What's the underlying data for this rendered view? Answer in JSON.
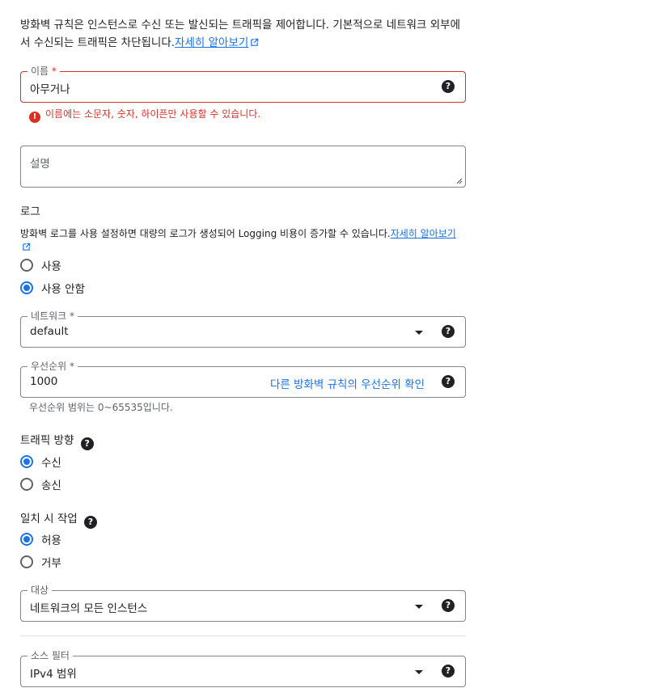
{
  "intro": {
    "text": "방화벽 규칙은 인스턴스로 수신 또는 발신되는 트래픽을 제어합니다. 기본적으로 네트워크 외부에서 수신되는 트래픽은 차단됩니다.",
    "link": "자세히 알아보기"
  },
  "name_field": {
    "label": "이름",
    "required_mark": "*",
    "value": "아무거나",
    "error_icon": "!",
    "error": "이름에는 소문자, 숫자, 하이픈만 사용할 수 있습니다."
  },
  "description_field": {
    "placeholder": "설명"
  },
  "logs": {
    "title": "로그",
    "desc": "방화벽 로그를 사용 설정하면 대량의 로그가 생성되어 Logging 비용이 증가할 수 있습니다.",
    "link": "자세히 알아보기",
    "options": [
      {
        "label": "사용",
        "selected": false
      },
      {
        "label": "사용 안함",
        "selected": true
      }
    ]
  },
  "network_field": {
    "label": "네트워크",
    "required_mark": "*",
    "value": "default"
  },
  "priority_field": {
    "label": "우선순위",
    "required_mark": "*",
    "value": "1000",
    "link": "다른 방화벽 규칙의 우선순위 확인",
    "hint": "우선순위 범위는 0~65535입니다."
  },
  "direction": {
    "title": "트래픽 방향",
    "options": [
      {
        "label": "수신",
        "selected": true
      },
      {
        "label": "송신",
        "selected": false
      }
    ]
  },
  "action": {
    "title": "일치 시 작업",
    "options": [
      {
        "label": "허용",
        "selected": true
      },
      {
        "label": "거부",
        "selected": false
      }
    ]
  },
  "target_field": {
    "label": "대상",
    "value": "네트워크의 모든 인스턴스"
  },
  "source_filter_field": {
    "label": "소스 필터",
    "value": "IPv4 범위"
  },
  "icons": {
    "help": "?",
    "help_icon": "help-circle-icon",
    "external_link_icon": "open-in-new-icon",
    "dropdown_icon": "arrow-drop-down-icon"
  },
  "colors": {
    "accent": "#1a73e8",
    "error": "#d93025",
    "border": "#80868b",
    "text": "#202124"
  }
}
